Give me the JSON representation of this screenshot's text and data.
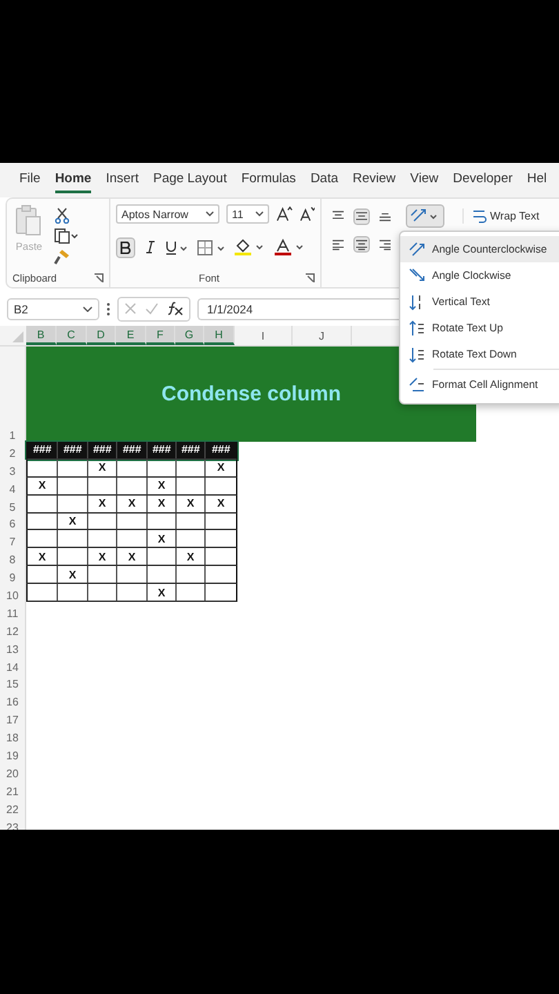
{
  "tabs": [
    {
      "label": "File",
      "selected": false
    },
    {
      "label": "Home",
      "selected": true
    },
    {
      "label": "Insert",
      "selected": false
    },
    {
      "label": "Page Layout",
      "selected": false
    },
    {
      "label": "Formulas",
      "selected": false
    },
    {
      "label": "Data",
      "selected": false
    },
    {
      "label": "Review",
      "selected": false
    },
    {
      "label": "View",
      "selected": false
    },
    {
      "label": "Developer",
      "selected": false
    },
    {
      "label": "Hel",
      "selected": false
    }
  ],
  "clipboard": {
    "label": "Clipboard",
    "paste": {
      "label": "Paste",
      "disabled": true
    }
  },
  "font": {
    "label": "Font",
    "font_name": "Aptos Narrow",
    "font_size": "11",
    "bold_pressed": true
  },
  "alignment": {
    "vertical_align": [
      {
        "selected": false
      },
      {
        "selected": true
      },
      {
        "selected": false
      }
    ],
    "horizontal_align": [
      {
        "selected": false
      },
      {
        "selected": true
      },
      {
        "selected": false
      }
    ],
    "orientation_open": true,
    "wrap_text": "Wrap Text"
  },
  "orientation_menu": [
    {
      "kind": "ccw",
      "label": "Angle Counterclockwise",
      "selected": true
    },
    {
      "kind": "cw",
      "label": "Angle Clockwise",
      "selected": false
    },
    {
      "kind": "vertical",
      "label": "Vertical Text",
      "selected": false
    },
    {
      "kind": "up",
      "label": "Rotate Text Up",
      "selected": false
    },
    {
      "kind": "down",
      "label": "Rotate Text Down",
      "selected": false
    },
    {
      "kind": "format",
      "label": "Format Cell Alignment",
      "selected": false
    }
  ],
  "formula_bar": {
    "name_box": "B2",
    "formula": "1/1/2024"
  },
  "sheet": {
    "columns": [
      "B",
      "C",
      "D",
      "E",
      "F",
      "G",
      "H",
      "I",
      "J"
    ],
    "banner": {
      "row": "1",
      "title": "Condense column"
    },
    "rows": [
      {
        "number": "2",
        "kind": "header",
        "selected": true,
        "cells": [
          "###",
          "###",
          "###",
          "###",
          "###",
          "###",
          "###"
        ]
      },
      {
        "number": "3",
        "kind": "data",
        "selected": false,
        "cells": [
          null,
          null,
          "X",
          null,
          null,
          null,
          "X"
        ]
      },
      {
        "number": "4",
        "kind": "data",
        "selected": false,
        "cells": [
          "X",
          null,
          null,
          null,
          "X",
          null,
          null
        ]
      },
      {
        "number": "5",
        "kind": "data",
        "selected": false,
        "cells": [
          null,
          null,
          "X",
          "X",
          "X",
          "X",
          "X"
        ]
      },
      {
        "number": "6",
        "kind": "data",
        "selected": false,
        "cells": [
          null,
          "X",
          null,
          null,
          null,
          null,
          null
        ]
      },
      {
        "number": "7",
        "kind": "data",
        "selected": false,
        "cells": [
          null,
          null,
          null,
          null,
          "X",
          null,
          null
        ]
      },
      {
        "number": "8",
        "kind": "data",
        "selected": false,
        "cells": [
          "X",
          null,
          "X",
          "X",
          null,
          "X",
          null
        ]
      },
      {
        "number": "9",
        "kind": "data",
        "selected": false,
        "cells": [
          null,
          "X",
          null,
          null,
          null,
          null,
          null
        ]
      },
      {
        "number": "10",
        "kind": "data",
        "selected": false,
        "cells": [
          null,
          null,
          null,
          null,
          "X",
          null,
          null
        ]
      }
    ],
    "empty_rows": [
      "11",
      "12",
      "13",
      "14",
      "15",
      "16",
      "17",
      "18",
      "19",
      "20",
      "21",
      "22",
      "23"
    ]
  }
}
